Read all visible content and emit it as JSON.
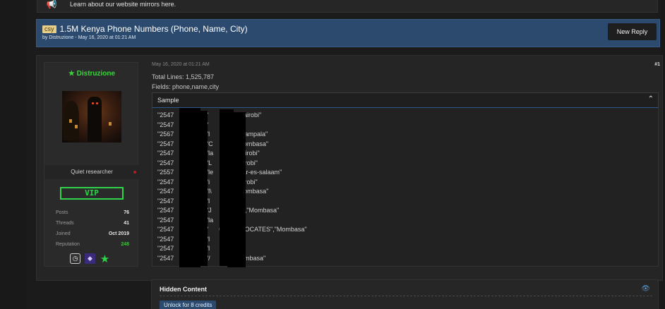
{
  "notice": {
    "text": "Learn about our website mirrors here."
  },
  "thread": {
    "prefix": "csy",
    "title": "1.5M Kenya Phone Numbers (Phone, Name, City)",
    "meta": "by Distruzione - May 16, 2020 at 01:21 AM",
    "new_reply_label": "New Reply"
  },
  "user": {
    "name": "Distruzione",
    "user_title": "Quiet researcher",
    "rank": "VIP",
    "stats": [
      {
        "label": "Posts",
        "value": "76"
      },
      {
        "label": "Threads",
        "value": "41"
      },
      {
        "label": "Joined",
        "value": "Oct 2019"
      },
      {
        "label": "Reputation",
        "value": "248"
      }
    ],
    "badge_icons": [
      "clock-badge-icon",
      "purple-badge-icon",
      "green-star-icon"
    ],
    "colors": {
      "name": "#3bd43b",
      "rank": "#2fd44a",
      "reputation": "#38c838"
    }
  },
  "post": {
    "date": "May 16, 2020 at 01:21 AM",
    "number": "#1",
    "total_lines": "Total Lines: 1,525,787",
    "fields": "Fields: phone,name,city",
    "spoiler_label": "Sample",
    "sample_lines": [
      "\"2547              5\",\"          ke\",\"Nairobi\"",
      "\"2547              8\",\"          airobi\"",
      "\"2567              9\",\"l      RCH\",\"Kampala\"",
      "\"2547              3\",\"C      TD\",\"Mombasa\"",
      "\"2547              1\",\"la      ga\",\"Nairobi\"",
      "\"2547              9\",\"L      OI\",\"Nairobi\"",
      "\"2557              0\",\"le      ics\",\"Dar-es-salaam\"",
      "\"2547              9\",\"i      ani\",\"Nairobi\"",
      "\"2547              2\",\"l\\      WA\",\"Mombasa\"",
      "\"2547              0\",\"l      alindi\"",
      "\"2547              9\",\"J      AMBILI\",\"Mombasa\"",
      "\"2547              0\",\"la      lairobi\"",
      "\"2547              4\",\"      CO. ADVOCATES\",\"Mombasa\"",
      "\"2547              0\",\"l      obi\"",
      "\"2547              9\",\"l      bi\"",
      "\"2547              7\",\"/      AR\",\"Mombasa\""
    ]
  },
  "hidden": {
    "title": "Hidden Content",
    "unlock_label": "Unlock for 8 credits"
  }
}
